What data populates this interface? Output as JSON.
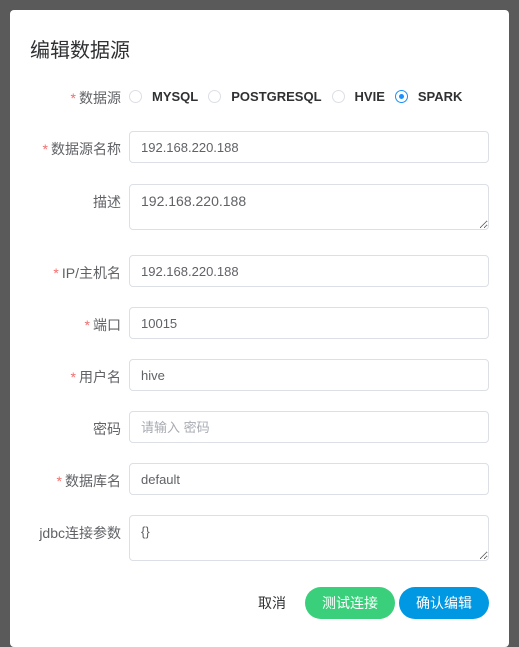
{
  "dialog": {
    "title": "编辑数据源"
  },
  "form": {
    "type": {
      "label": "数据源",
      "options": [
        "MYSQL",
        "POSTGRESQL",
        "HVIE",
        "SPARK"
      ],
      "selected": "SPARK"
    },
    "name": {
      "label": "数据源名称",
      "value": "192.168.220.188"
    },
    "desc": {
      "label": "描述",
      "value": "192.168.220.188"
    },
    "host": {
      "label": "IP/主机名",
      "value": "192.168.220.188"
    },
    "port": {
      "label": "端口",
      "value": "10015"
    },
    "user": {
      "label": "用户名",
      "value": "hive"
    },
    "password": {
      "label": "密码",
      "value": "",
      "placeholder": "请输入 密码"
    },
    "database": {
      "label": "数据库名",
      "value": "default"
    },
    "jdbc": {
      "label": "jdbc连接参数",
      "value": "{}"
    }
  },
  "footer": {
    "cancel": "取消",
    "test": "测试连接",
    "confirm": "确认编辑",
    "test_color": "#3ad07b",
    "confirm_color": "#0098e3"
  }
}
